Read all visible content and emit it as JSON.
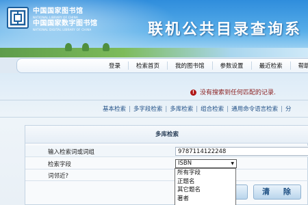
{
  "header": {
    "logo_cn_1": "中国国家图书馆",
    "logo_en_1": "NATIONAL LIBRARY OF CHINA",
    "logo_cn_2": "中国国家数字图书馆",
    "logo_en_2": "NATIONAL DIGITAL LIBRARY OF CHINA",
    "title": "联机公共目录查询系"
  },
  "nav": {
    "items": [
      "登录",
      "检索首页",
      "我的图书馆",
      "参数设置",
      "最近检索",
      "帮助"
    ]
  },
  "message": {
    "error": "没有搜索到任何匹配的记录."
  },
  "subnav": {
    "items": [
      "基本检索",
      "多字段检索",
      "多库检索",
      "组合检索",
      "通用命令语言检索",
      "分"
    ]
  },
  "form": {
    "title": "多库检索",
    "keyword_label": "输入检索词或词组",
    "keyword_value": "9787114122248",
    "field_label": "检索字段",
    "field_selected": "ISBN",
    "adjacent_label": "词邻近?",
    "field_options": [
      "所有字段",
      "正题名",
      "其它题名",
      "著者"
    ],
    "search_button": "确",
    "clear_button": "清 除"
  },
  "colors": {
    "header_blue": "#2f8ddc",
    "error_red": "#8a1c1c",
    "link_blue": "#1f4f86"
  }
}
